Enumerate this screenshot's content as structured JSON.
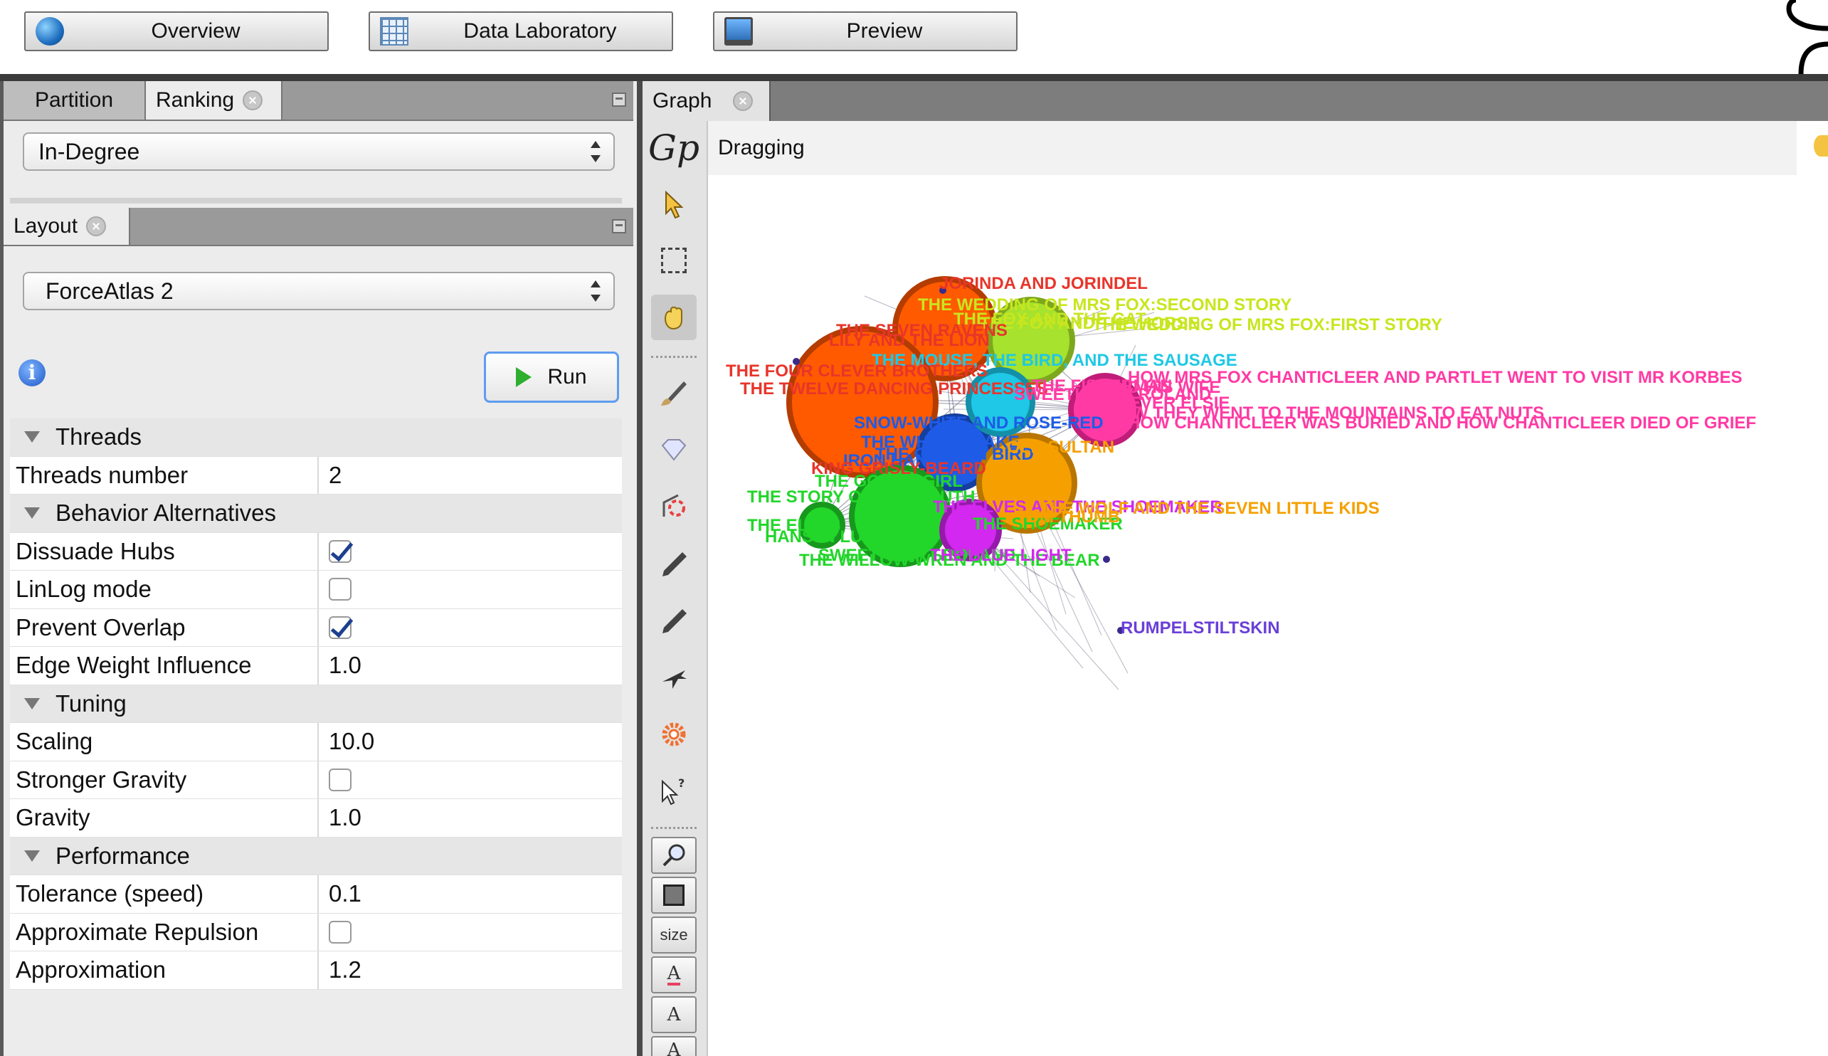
{
  "top_toolbar": {
    "overview_label": "Overview",
    "data_laboratory_label": "Data Laboratory",
    "preview_label": "Preview"
  },
  "ranking_panel": {
    "tabs": [
      "Partition",
      "Ranking"
    ],
    "selected_metric": "In-Degree"
  },
  "layout_panel": {
    "tab_label": "Layout",
    "selected_algorithm": "ForceAtlas 2",
    "run_label": "Run"
  },
  "properties": [
    {
      "type": "category",
      "label": "Threads"
    },
    {
      "type": "text",
      "label": "Threads number",
      "value": "2"
    },
    {
      "type": "category",
      "label": "Behavior Alternatives"
    },
    {
      "type": "check",
      "label": "Dissuade Hubs",
      "checked": true
    },
    {
      "type": "check",
      "label": "LinLog mode",
      "checked": false
    },
    {
      "type": "check",
      "label": "Prevent Overlap",
      "checked": true
    },
    {
      "type": "text",
      "label": "Edge Weight Influence",
      "value": "1.0"
    },
    {
      "type": "category",
      "label": "Tuning"
    },
    {
      "type": "text",
      "label": "Scaling",
      "value": "10.0"
    },
    {
      "type": "check",
      "label": "Stronger Gravity",
      "checked": false
    },
    {
      "type": "text",
      "label": "Gravity",
      "value": "1.0"
    },
    {
      "type": "category",
      "label": "Performance"
    },
    {
      "type": "text",
      "label": "Tolerance (speed)",
      "value": "0.1"
    },
    {
      "type": "check",
      "label": "Approximate Repulsion",
      "checked": false
    },
    {
      "type": "text",
      "label": "Approximation",
      "value": "1.2"
    }
  ],
  "graph_panel": {
    "tab_label": "Graph",
    "status": "Dragging",
    "size_label": "size",
    "font_a": "A"
  },
  "graph": {
    "nodes": [
      {
        "color": "#ff5a00",
        "edge_color": "#b43c00"
      },
      {
        "color": "#ff5a00",
        "edge_color": "#b43c00"
      },
      {
        "color": "#a6e22e",
        "edge_color": "#7da81e"
      },
      {
        "color": "#ff3aa4",
        "edge_color": "#c01d79"
      },
      {
        "color": "#1e5be6",
        "edge_color": "#153f9e"
      },
      {
        "color": "#f5a000",
        "edge_color": "#b87500"
      },
      {
        "color": "#22d62a",
        "edge_color": "#17981d"
      },
      {
        "color": "#22d62a",
        "edge_color": "#17981d"
      },
      {
        "color": "#d228ef",
        "edge_color": "#951aaa"
      },
      {
        "color": "#1ec8e6",
        "edge_color": "#1390a8"
      }
    ],
    "labels": [
      {
        "text": "JORINDA AND JORINDEL",
        "color": "#e8352a"
      },
      {
        "text": "THE WEDDING OF MRS FOX:SECOND STORY",
        "color": "#c8e61e"
      },
      {
        "text": "THE FOX AND THE CAT",
        "color": "#c8e61e"
      },
      {
        "text": "THE FOX AND THE HORSE",
        "color": "#c8e61e"
      },
      {
        "text": "THE WEDDING OF MRS FOX:FIRST STORY",
        "color": "#c8e61e"
      },
      {
        "text": "THE SEVEN RAVENS",
        "color": "#e8352a"
      },
      {
        "text": "LILY AND THE LION",
        "color": "#e8352a"
      },
      {
        "text": "THE MOUSE, THE BIRD, AND THE SAUSAGE",
        "color": "#1ec8e6"
      },
      {
        "text": "THE FOUR CLEVER BROTHERS",
        "color": "#e8352a"
      },
      {
        "text": "THE TWELVE DANCING PRINCESSES",
        "color": "#e8352a"
      },
      {
        "text": "HOW MRS FOX CHANTICLEER AND PARTLET WENT TO VISIT MR KORBES",
        "color": "#ff3aa4"
      },
      {
        "text": "AND HIS WIFE",
        "color": "#ff3aa4"
      },
      {
        "text": "THE FISHERMAN",
        "color": "#ff3aa4"
      },
      {
        "text": "SWEETHEART ROLAND",
        "color": "#ff3aa4"
      },
      {
        "text": "CLEVER ELSIE",
        "color": "#ff3aa4"
      },
      {
        "text": "HOW THEY WENT TO THE MOUNTAINS TO EAT NUTS",
        "color": "#ff3aa4"
      },
      {
        "text": "HOW CHANTICLEER WAS BURIED AND HOW CHANTICLEER DIED OF GRIEF",
        "color": "#ff3aa4"
      },
      {
        "text": "SNOW-WHITE AND ROSE-RED",
        "color": "#1e5be6"
      },
      {
        "text": "THE WHITE SNAKE",
        "color": "#1e5be6"
      },
      {
        "text": "IRON HANS",
        "color": "#1e5be6"
      },
      {
        "text": "THE GOLDEN BIRD",
        "color": "#1e5be6"
      },
      {
        "text": "OLD SULTAN",
        "color": "#f5a000"
      },
      {
        "text": "KING GRISLY-BEARD",
        "color": "#e8352a"
      },
      {
        "text": "THE GOOSE-GIRL",
        "color": "#22d62a"
      },
      {
        "text": "THE SHOEMAKER",
        "color": "#22d62a"
      },
      {
        "text": "THE STORY OF THE YOUTH",
        "color": "#22d62a"
      },
      {
        "text": "THE ELVES",
        "color": "#22d62a"
      },
      {
        "text": "HANS IN LUCK",
        "color": "#22d62a"
      },
      {
        "text": "SWEETHEART ROLAND",
        "color": "#22d62a"
      },
      {
        "text": "THE WILLOW-WREN AND THE BEAR",
        "color": "#22d62a"
      },
      {
        "text": "THE BLUE LIGHT",
        "color": "#d228ef"
      },
      {
        "text": "THE ELVES AND THE SHOEMAKER",
        "color": "#d228ef"
      },
      {
        "text": "THE WOLF AND THE SEVEN LITTLE KIDS",
        "color": "#f5a000"
      },
      {
        "text": "TOM THUMB",
        "color": "#f5a000"
      },
      {
        "text": "RUMPELSTILTSKIN",
        "color": "#6a3fd8"
      }
    ]
  }
}
